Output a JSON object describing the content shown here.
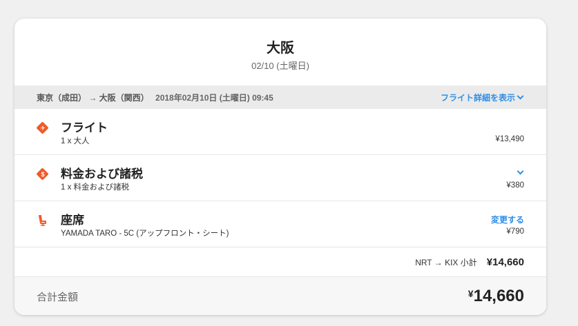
{
  "header": {
    "city": "大阪",
    "date": "02/10 (土曜日)"
  },
  "route_bar": {
    "route": "東京（成田） → 大阪（関西）",
    "datetime": "2018年02月10日 (土曜日) 09:45",
    "detail_link": "フライト詳細を表示"
  },
  "items": [
    {
      "title": "フライト",
      "sub": "1 x 大人",
      "price": "¥13,490",
      "icon": "plane-icon"
    },
    {
      "title": "料金および諸税",
      "sub": "1 x 料金および諸税",
      "price": "¥380",
      "icon": "dollar-tag-icon"
    },
    {
      "title": "座席",
      "sub": "YAMADA TARO - 5C (アップフロント・シート)",
      "price": "¥790",
      "action": "変更する",
      "icon": "seat-icon"
    }
  ],
  "subtotal": {
    "label": "NRT → KIX 小計",
    "value": "¥14,660"
  },
  "total": {
    "label": "合計金額",
    "currency": "¥",
    "value": "14,660"
  },
  "colors": {
    "accent": "#2f8fe6",
    "icon": "#f05a28"
  }
}
